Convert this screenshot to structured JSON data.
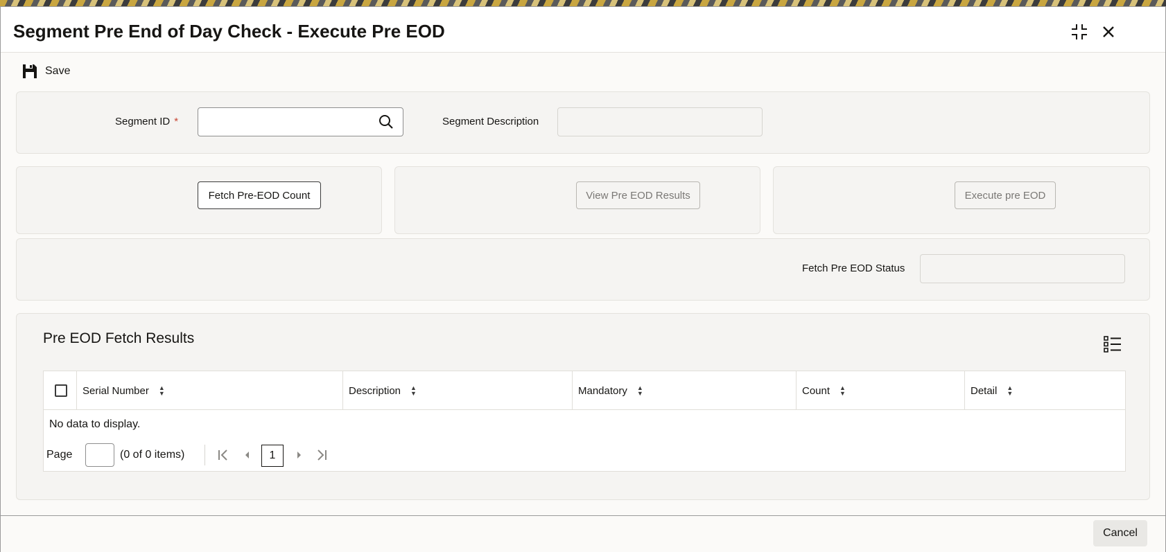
{
  "window": {
    "title": "Segment Pre End of Day Check - Execute Pre EOD",
    "maximize_icon": "maximize-icon",
    "close_icon": "close-icon"
  },
  "toolbar": {
    "save_label": "Save",
    "save_icon": "save-icon"
  },
  "form": {
    "segment_id_label": "Segment ID",
    "required_marker": "*",
    "segment_id_value": "",
    "segment_description_label": "Segment Description",
    "segment_description_value": "",
    "fetch_status_label": "Fetch Pre EOD Status",
    "fetch_status_value": ""
  },
  "actions": {
    "fetch_count_label": "Fetch Pre-EOD Count",
    "view_results_label": "View Pre EOD Results",
    "execute_label": "Execute pre EOD"
  },
  "results": {
    "title": "Pre EOD Fetch Results",
    "columns": [
      "Serial Number",
      "Description",
      "Mandatory",
      "Count",
      "Detail"
    ],
    "empty_message": "No data to display.",
    "pager": {
      "page_label": "Page",
      "page_value": "",
      "items_text": "(0 of 0 items)",
      "current_page": "1"
    }
  },
  "footer": {
    "cancel_label": "Cancel"
  },
  "colors": {
    "text": "#161513",
    "panel_bg": "#f5f4f2",
    "required": "#c74634",
    "disabled_text": "#7a7875"
  }
}
